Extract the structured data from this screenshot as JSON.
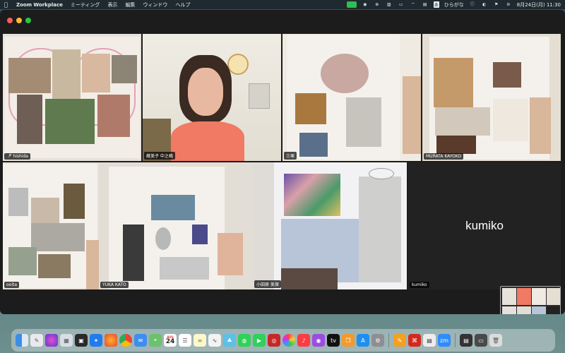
{
  "menubar": {
    "app_name": "Zoom Workplace",
    "menus": [
      "ミーティング",
      "表示",
      "編集",
      "ウィンドウ",
      "ヘルプ"
    ],
    "ime": "あ",
    "ime_label": "ひらがな",
    "datetime": "8月24日(月)  11:30"
  },
  "participants": [
    {
      "name": "hishida",
      "muted": true
    },
    {
      "name": "蔵美子 中之嶋",
      "active": true
    },
    {
      "name": "三塚"
    },
    {
      "name": "MURATA KAYOKO"
    },
    {
      "name": "ooita"
    },
    {
      "name": "YUKA KATO"
    },
    {
      "name": "小田原 美保"
    },
    {
      "name": "kumiko",
      "big_label": "kumiko",
      "video_off": true
    }
  ],
  "dock": {
    "calendar_day": "24",
    "calendar_month": "AUG",
    "apps": [
      "finder-icon",
      "launchpad-icon",
      "siri-icon",
      "launchpad-grid-icon",
      "mission-control-icon",
      "safari-icon",
      "firefox-icon",
      "chrome-icon",
      "mail-icon",
      "photos-icon",
      "calendar-icon",
      "reminders-icon",
      "notes-icon",
      "freeform-icon",
      "maps-icon",
      "messages-icon",
      "facetime-icon",
      "photo-booth-icon",
      "photos-app-icon",
      "music-icon",
      "podcasts-icon",
      "appletv-icon",
      "books-icon",
      "appstore-icon",
      "settings-icon",
      "pages-icon",
      "acrobat-icon",
      "preview-icon",
      "zoom-icon",
      "downloads-icon",
      "trash-icon"
    ]
  },
  "colors": {
    "zoom_green": "#4fae4f",
    "menubar_bg": "#1f2a30",
    "window_bg": "#1c1c1c"
  }
}
